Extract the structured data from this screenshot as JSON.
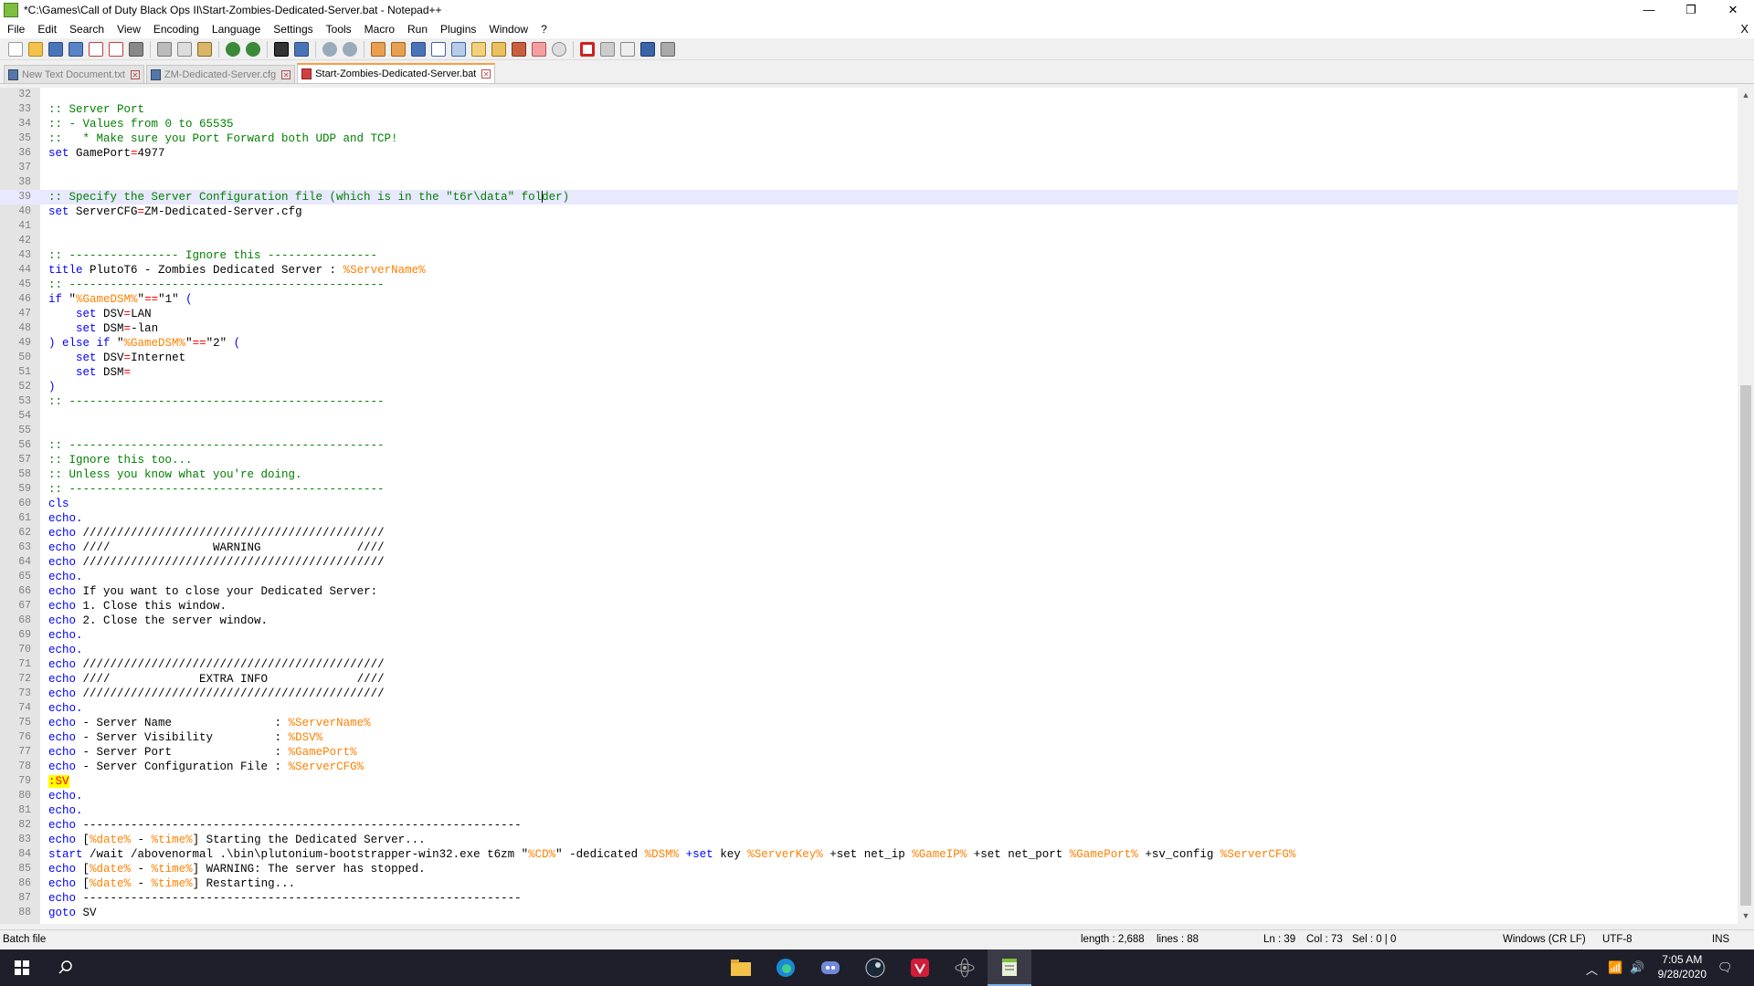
{
  "window": {
    "title": "*C:\\Games\\Call of Duty Black Ops II\\Start-Zombies-Dedicated-Server.bat - Notepad++",
    "minimize": "—",
    "maximize": "❐",
    "close": "✕"
  },
  "menu": {
    "items": [
      "File",
      "Edit",
      "Search",
      "View",
      "Encoding",
      "Language",
      "Settings",
      "Tools",
      "Macro",
      "Run",
      "Plugins",
      "Window",
      "?"
    ],
    "close_doc": "X"
  },
  "tabs": [
    {
      "label": "New Text Document.txt",
      "active": false
    },
    {
      "label": "ZM-Dedicated-Server.cfg",
      "active": false
    },
    {
      "label": "Start-Zombies-Dedicated-Server.bat",
      "active": true
    }
  ],
  "editor": {
    "current_line": 39,
    "lines": [
      {
        "n": "32",
        "tokens": []
      },
      {
        "n": "33",
        "tokens": [
          {
            "t": ":: Server Port",
            "c": "com"
          }
        ]
      },
      {
        "n": "34",
        "tokens": [
          {
            "t": ":: - Values from 0 to 65535",
            "c": "com"
          }
        ]
      },
      {
        "n": "35",
        "tokens": [
          {
            "t": "::   * Make sure you Port Forward both UDP and TCP!",
            "c": "com"
          }
        ]
      },
      {
        "n": "36",
        "tokens": [
          {
            "t": "set",
            "c": "kw"
          },
          {
            "t": " GamePort",
            "c": "txt"
          },
          {
            "t": "=",
            "c": "op"
          },
          {
            "t": "4977",
            "c": "txt"
          }
        ]
      },
      {
        "n": "37",
        "tokens": []
      },
      {
        "n": "38",
        "tokens": []
      },
      {
        "n": "39",
        "tokens": [
          {
            "t": ":: Specify the Server Configuration file (which is in the \"t6r\\data\" fol",
            "c": "com"
          },
          {
            "t": "|",
            "c": "caret"
          },
          {
            "t": "der)",
            "c": "com"
          }
        ]
      },
      {
        "n": "40",
        "tokens": [
          {
            "t": "set",
            "c": "kw"
          },
          {
            "t": " ServerCFG",
            "c": "txt"
          },
          {
            "t": "=",
            "c": "op"
          },
          {
            "t": "ZM-Dedicated-Server.cfg",
            "c": "txt"
          }
        ]
      },
      {
        "n": "41",
        "tokens": []
      },
      {
        "n": "42",
        "tokens": []
      },
      {
        "n": "43",
        "tokens": [
          {
            "t": ":: ---------------- Ignore this ----------------",
            "c": "com"
          }
        ]
      },
      {
        "n": "44",
        "tokens": [
          {
            "t": "title",
            "c": "kw"
          },
          {
            "t": " PlutoT6 - Zombies Dedicated Server : ",
            "c": "txt"
          },
          {
            "t": "%ServerName%",
            "c": "var"
          }
        ]
      },
      {
        "n": "45",
        "tokens": [
          {
            "t": ":: ----------------------------------------------",
            "c": "com"
          }
        ]
      },
      {
        "n": "46",
        "tokens": [
          {
            "t": "if",
            "c": "kw"
          },
          {
            "t": " \"",
            "c": "txt"
          },
          {
            "t": "%GameDSM%",
            "c": "var"
          },
          {
            "t": "\"",
            "c": "txt"
          },
          {
            "t": "==",
            "c": "op"
          },
          {
            "t": "\"1\" ",
            "c": "txt"
          },
          {
            "t": "(",
            "c": "kw"
          }
        ]
      },
      {
        "n": "47",
        "tokens": [
          {
            "t": "    ",
            "c": "txt"
          },
          {
            "t": "set",
            "c": "kw"
          },
          {
            "t": " DSV",
            "c": "txt"
          },
          {
            "t": "=",
            "c": "op"
          },
          {
            "t": "LAN",
            "c": "txt"
          }
        ]
      },
      {
        "n": "48",
        "tokens": [
          {
            "t": "    ",
            "c": "txt"
          },
          {
            "t": "set",
            "c": "kw"
          },
          {
            "t": " DSM",
            "c": "txt"
          },
          {
            "t": "=",
            "c": "op"
          },
          {
            "t": "-lan",
            "c": "txt"
          }
        ]
      },
      {
        "n": "49",
        "tokens": [
          {
            "t": ") ",
            "c": "kw"
          },
          {
            "t": "else if",
            "c": "kw"
          },
          {
            "t": " \"",
            "c": "txt"
          },
          {
            "t": "%GameDSM%",
            "c": "var"
          },
          {
            "t": "\"",
            "c": "txt"
          },
          {
            "t": "==",
            "c": "op"
          },
          {
            "t": "\"2\" ",
            "c": "txt"
          },
          {
            "t": "(",
            "c": "kw"
          }
        ]
      },
      {
        "n": "50",
        "tokens": [
          {
            "t": "    ",
            "c": "txt"
          },
          {
            "t": "set",
            "c": "kw"
          },
          {
            "t": " DSV",
            "c": "txt"
          },
          {
            "t": "=",
            "c": "op"
          },
          {
            "t": "Internet",
            "c": "txt"
          }
        ]
      },
      {
        "n": "51",
        "tokens": [
          {
            "t": "    ",
            "c": "txt"
          },
          {
            "t": "set",
            "c": "kw"
          },
          {
            "t": " DSM",
            "c": "txt"
          },
          {
            "t": "=",
            "c": "op"
          }
        ]
      },
      {
        "n": "52",
        "tokens": [
          {
            "t": ")",
            "c": "kw"
          }
        ]
      },
      {
        "n": "53",
        "tokens": [
          {
            "t": ":: ----------------------------------------------",
            "c": "com"
          }
        ]
      },
      {
        "n": "54",
        "tokens": []
      },
      {
        "n": "55",
        "tokens": []
      },
      {
        "n": "56",
        "tokens": [
          {
            "t": ":: ----------------------------------------------",
            "c": "com"
          }
        ]
      },
      {
        "n": "57",
        "tokens": [
          {
            "t": ":: Ignore this too...",
            "c": "com"
          }
        ]
      },
      {
        "n": "58",
        "tokens": [
          {
            "t": ":: Unless you know what you're doing.",
            "c": "com"
          }
        ]
      },
      {
        "n": "59",
        "tokens": [
          {
            "t": ":: ----------------------------------------------",
            "c": "com"
          }
        ]
      },
      {
        "n": "60",
        "tokens": [
          {
            "t": "cls",
            "c": "kw"
          }
        ]
      },
      {
        "n": "61",
        "tokens": [
          {
            "t": "echo.",
            "c": "kw"
          }
        ]
      },
      {
        "n": "62",
        "tokens": [
          {
            "t": "echo",
            "c": "kw"
          },
          {
            "t": " ////////////////////////////////////////////",
            "c": "txt"
          }
        ]
      },
      {
        "n": "63",
        "tokens": [
          {
            "t": "echo",
            "c": "kw"
          },
          {
            "t": " ////               WARNING              ////",
            "c": "txt"
          }
        ]
      },
      {
        "n": "64",
        "tokens": [
          {
            "t": "echo",
            "c": "kw"
          },
          {
            "t": " ////////////////////////////////////////////",
            "c": "txt"
          }
        ]
      },
      {
        "n": "65",
        "tokens": [
          {
            "t": "echo.",
            "c": "kw"
          }
        ]
      },
      {
        "n": "66",
        "tokens": [
          {
            "t": "echo",
            "c": "kw"
          },
          {
            "t": " If you want to close your Dedicated Server:",
            "c": "txt"
          }
        ]
      },
      {
        "n": "67",
        "tokens": [
          {
            "t": "echo",
            "c": "kw"
          },
          {
            "t": " 1. Close this window.",
            "c": "txt"
          }
        ]
      },
      {
        "n": "68",
        "tokens": [
          {
            "t": "echo",
            "c": "kw"
          },
          {
            "t": " 2. Close the server window.",
            "c": "txt"
          }
        ]
      },
      {
        "n": "69",
        "tokens": [
          {
            "t": "echo.",
            "c": "kw"
          }
        ]
      },
      {
        "n": "70",
        "tokens": [
          {
            "t": "echo.",
            "c": "kw"
          }
        ]
      },
      {
        "n": "71",
        "tokens": [
          {
            "t": "echo",
            "c": "kw"
          },
          {
            "t": " ////////////////////////////////////////////",
            "c": "txt"
          }
        ]
      },
      {
        "n": "72",
        "tokens": [
          {
            "t": "echo",
            "c": "kw"
          },
          {
            "t": " ////             EXTRA INFO             ////",
            "c": "txt"
          }
        ]
      },
      {
        "n": "73",
        "tokens": [
          {
            "t": "echo",
            "c": "kw"
          },
          {
            "t": " ////////////////////////////////////////////",
            "c": "txt"
          }
        ]
      },
      {
        "n": "74",
        "tokens": [
          {
            "t": "echo.",
            "c": "kw"
          }
        ]
      },
      {
        "n": "75",
        "tokens": [
          {
            "t": "echo",
            "c": "kw"
          },
          {
            "t": " - Server Name               : ",
            "c": "txt"
          },
          {
            "t": "%ServerName%",
            "c": "var"
          }
        ]
      },
      {
        "n": "76",
        "tokens": [
          {
            "t": "echo",
            "c": "kw"
          },
          {
            "t": " - Server Visibility         : ",
            "c": "txt"
          },
          {
            "t": "%DSV%",
            "c": "var"
          }
        ]
      },
      {
        "n": "77",
        "tokens": [
          {
            "t": "echo",
            "c": "kw"
          },
          {
            "t": " - Server Port               : ",
            "c": "txt"
          },
          {
            "t": "%GamePort%",
            "c": "var"
          }
        ]
      },
      {
        "n": "78",
        "tokens": [
          {
            "t": "echo",
            "c": "kw"
          },
          {
            "t": " - Server Configuration File : ",
            "c": "txt"
          },
          {
            "t": "%ServerCFG%",
            "c": "var"
          }
        ]
      },
      {
        "n": "79",
        "tokens": [
          {
            "t": ":SV",
            "c": "lab"
          }
        ]
      },
      {
        "n": "80",
        "tokens": [
          {
            "t": "echo.",
            "c": "kw"
          }
        ]
      },
      {
        "n": "81",
        "tokens": [
          {
            "t": "echo.",
            "c": "kw"
          }
        ]
      },
      {
        "n": "82",
        "tokens": [
          {
            "t": "echo",
            "c": "kw"
          },
          {
            "t": " ----------------------------------------------------------------",
            "c": "txt"
          }
        ]
      },
      {
        "n": "83",
        "tokens": [
          {
            "t": "echo",
            "c": "kw"
          },
          {
            "t": " [",
            "c": "txt"
          },
          {
            "t": "%date%",
            "c": "var"
          },
          {
            "t": " - ",
            "c": "txt"
          },
          {
            "t": "%time%",
            "c": "var"
          },
          {
            "t": "] Starting the Dedicated Server...",
            "c": "txt"
          }
        ]
      },
      {
        "n": "84",
        "tokens": [
          {
            "t": "start",
            "c": "kw"
          },
          {
            "t": " /wait /abovenormal .\\bin\\plutonium-bootstrapper-win32.exe t6zm \"",
            "c": "txt"
          },
          {
            "t": "%CD%",
            "c": "var"
          },
          {
            "t": "\" -dedicated ",
            "c": "txt"
          },
          {
            "t": "%DSM%",
            "c": "var"
          },
          {
            "t": " +set",
            "c": "kw"
          },
          {
            "t": " key ",
            "c": "txt"
          },
          {
            "t": "%ServerKey%",
            "c": "var"
          },
          {
            "t": " +set net_ip ",
            "c": "txt"
          },
          {
            "t": "%GameIP%",
            "c": "var"
          },
          {
            "t": " +set net_port ",
            "c": "txt"
          },
          {
            "t": "%GamePort%",
            "c": "var"
          },
          {
            "t": " +sv_config ",
            "c": "txt"
          },
          {
            "t": "%ServerCFG%",
            "c": "var"
          }
        ]
      },
      {
        "n": "85",
        "tokens": [
          {
            "t": "echo",
            "c": "kw"
          },
          {
            "t": " [",
            "c": "txt"
          },
          {
            "t": "%date%",
            "c": "var"
          },
          {
            "t": " - ",
            "c": "txt"
          },
          {
            "t": "%time%",
            "c": "var"
          },
          {
            "t": "] WARNING: The server has stopped.",
            "c": "txt"
          }
        ]
      },
      {
        "n": "86",
        "tokens": [
          {
            "t": "echo",
            "c": "kw"
          },
          {
            "t": " [",
            "c": "txt"
          },
          {
            "t": "%date%",
            "c": "var"
          },
          {
            "t": " - ",
            "c": "txt"
          },
          {
            "t": "%time%",
            "c": "var"
          },
          {
            "t": "] Restarting...",
            "c": "txt"
          }
        ]
      },
      {
        "n": "87",
        "tokens": [
          {
            "t": "echo",
            "c": "kw"
          },
          {
            "t": " ----------------------------------------------------------------",
            "c": "txt"
          }
        ]
      },
      {
        "n": "88",
        "tokens": [
          {
            "t": "goto",
            "c": "kw"
          },
          {
            "t": " SV",
            "c": "txt"
          }
        ]
      }
    ]
  },
  "status": {
    "filetype": "Batch file",
    "length": "length : 2,688",
    "lines": "lines : 88",
    "ln": "Ln : 39",
    "col": "Col : 73",
    "sel": "Sel : 0 | 0",
    "eol": "Windows (CR LF)",
    "encoding": "UTF-8",
    "mode": "INS"
  },
  "taskbar": {
    "time": "7:05 AM",
    "date": "9/28/2020"
  }
}
